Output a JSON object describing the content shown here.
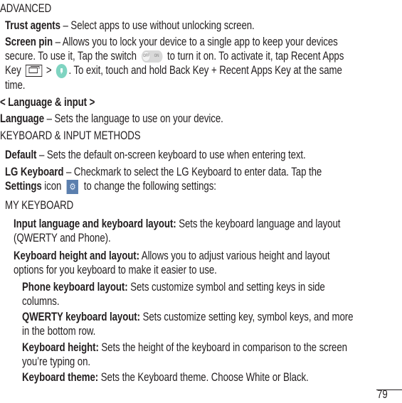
{
  "document": {
    "page_number": "79",
    "sections": {
      "advanced_heading": "ADVANCED",
      "trust_agents": {
        "term": "Trust agents",
        "text": " – Select apps to use without unlocking screen."
      },
      "screen_pin": {
        "term": "Screen pin",
        "line1": " – Allows you to lock your device to a single app to keep your devices",
        "line2_a": "secure. To use it, Tap the switch",
        "line2_b": "to turn it on. To activate it, tap Recent Apps",
        "line3_a": "Key",
        "line3_gt": ">",
        "line3_b": ". To exit, touch and hold Back Key + Recent Apps Key at the same",
        "line4": "time.",
        "switch_icon": {
          "off_label": "OFF",
          "on_label": "ON"
        }
      },
      "language_input_heading": "< Language & input >",
      "language": {
        "term": "Language",
        "text": " – Sets the language to use on your device."
      },
      "keyboard_methods_heading": "KEYBOARD & INPUT METHODS",
      "default": {
        "term": "Default",
        "text": " – Sets the default on-screen keyboard to use when entering text."
      },
      "lg_keyboard": {
        "term": "LG Keyboard",
        "line1": " – Checkmark to select the LG Keyboard to enter data. Tap the",
        "line2_term": "Settings",
        "line2_a": " icon",
        "line2_b": "to change the following settings:"
      },
      "my_keyboard_heading": "MY KEYBOARD",
      "input_language_layout": {
        "term": "Input language and keyboard layout:",
        "line1": " Sets the keyboard language and layout",
        "line2": "(QWERTY and Phone)."
      },
      "keyboard_height_layout": {
        "term": "Keyboard height and layout:",
        "line1": " Allows you to adjust various height and layout",
        "line2": "options for you keyboard to make it easier to use."
      },
      "phone_keyboard_layout": {
        "term": "Phone keyboard layout:",
        "line1": " Sets customize symbol and setting keys in side",
        "line2": "columns."
      },
      "qwerty_keyboard_layout": {
        "term": "QWERTY keyboard layout:",
        "line1": " Sets customize setting key, symbol keys, and more",
        "line2": "in the bottom row."
      },
      "keyboard_height": {
        "term": "Keyboard height:",
        "line1": " Sets the height of the keyboard in comparison to the screen",
        "line2": "you’re typing on."
      },
      "keyboard_theme": {
        "term": "Keyboard theme:",
        "line1": " Sets the Keyboard theme. Choose White or Black."
      }
    },
    "colors": {
      "text": "#231f20",
      "pin_button": "#7fd4c1",
      "settings_icon": "#5b7fae",
      "switch_track": "#d9d9d9"
    }
  }
}
